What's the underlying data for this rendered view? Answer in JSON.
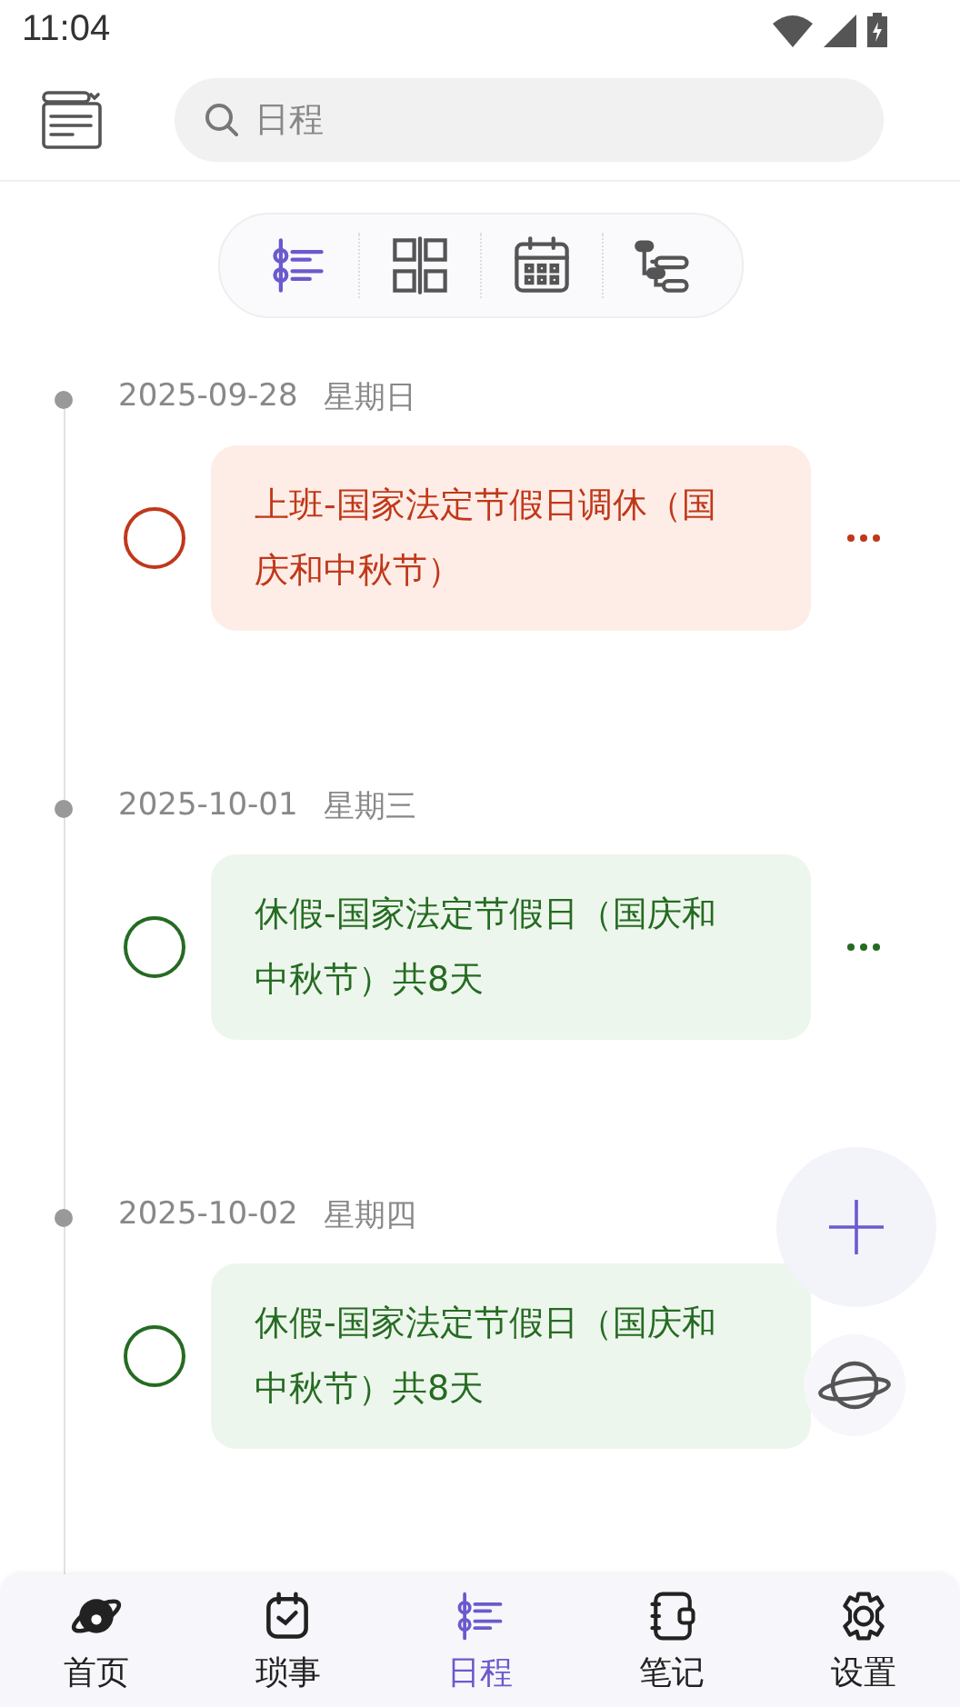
{
  "status_bar": {
    "time": "11:04"
  },
  "search": {
    "placeholder": "日程"
  },
  "view_switcher": [
    {
      "kind": "timeline",
      "selected": true
    },
    {
      "kind": "grid",
      "selected": false
    },
    {
      "kind": "calendar",
      "selected": false
    },
    {
      "kind": "gantt",
      "selected": false
    }
  ],
  "days": [
    {
      "date": "2025-09-28",
      "weekday": "星期日",
      "events": [
        {
          "title": "上班-国家法定节假日调休（国庆和中秋节）",
          "kind": "work",
          "checked": false
        }
      ]
    },
    {
      "date": "2025-10-01",
      "weekday": "星期三",
      "events": [
        {
          "title": "休假-国家法定节假日（国庆和中秋节）共8天",
          "kind": "holiday",
          "checked": false
        }
      ]
    },
    {
      "date": "2025-10-02",
      "weekday": "星期四",
      "events": [
        {
          "title": "休假-国家法定节假日（国庆和中秋节）共8天",
          "kind": "holiday",
          "checked": false
        }
      ]
    }
  ],
  "bottom_nav": [
    {
      "label": "首页",
      "kind": "planet",
      "selected": false
    },
    {
      "label": "琐事",
      "kind": "task",
      "selected": false
    },
    {
      "label": "日程",
      "kind": "timeline",
      "selected": true
    },
    {
      "label": "笔记",
      "kind": "notebook",
      "selected": false
    },
    {
      "label": "设置",
      "kind": "gear",
      "selected": false
    }
  ]
}
